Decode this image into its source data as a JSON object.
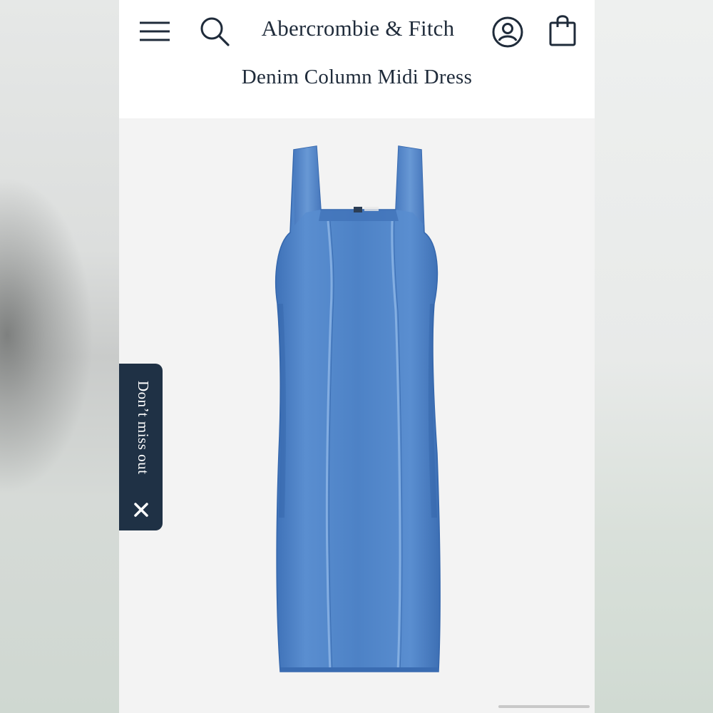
{
  "brand": {
    "name": "Abercrombie & Fitch"
  },
  "header": {
    "icons": [
      "menu-icon",
      "search-icon",
      "account-icon",
      "shopping-bag-icon"
    ]
  },
  "product": {
    "title": "Denim Column Midi Dress",
    "image": "denim-column-midi-dress-photo"
  },
  "promo": {
    "label": "Don’t miss out",
    "close_icon": "close-icon"
  },
  "colors": {
    "navy": "#1f3145",
    "text": "#1f2b3a",
    "denim": "#4f82c4",
    "page_bg": "#f3f3f3"
  }
}
